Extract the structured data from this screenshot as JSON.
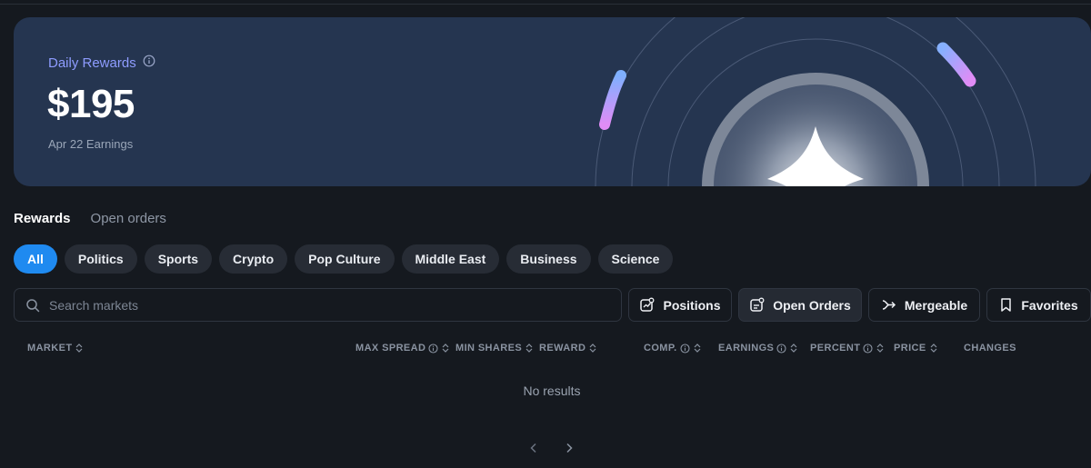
{
  "hero": {
    "title": "Daily Rewards",
    "amount": "$195",
    "subtitle": "Apr 22 Earnings"
  },
  "tabs": [
    {
      "label": "Rewards",
      "active": true
    },
    {
      "label": "Open orders",
      "active": false
    }
  ],
  "categories": [
    {
      "label": "All",
      "active": true
    },
    {
      "label": "Politics"
    },
    {
      "label": "Sports"
    },
    {
      "label": "Crypto"
    },
    {
      "label": "Pop Culture"
    },
    {
      "label": "Middle East"
    },
    {
      "label": "Business"
    },
    {
      "label": "Science"
    }
  ],
  "search": {
    "placeholder": "Search markets",
    "value": ""
  },
  "toolbar": {
    "positions": "Positions",
    "open_orders": "Open Orders",
    "mergeable": "Mergeable",
    "favorites": "Favorites"
  },
  "table": {
    "columns": {
      "market": "MARKET",
      "max_spread": "MAX SPREAD",
      "min_shares": "MIN SHARES",
      "reward": "REWARD",
      "comp": "COMP.",
      "earnings": "EARNINGS",
      "percent": "PERCENT",
      "price": "PRICE",
      "changes": "CHANGES"
    },
    "empty_text": "No results"
  },
  "colors": {
    "background": "#15191f",
    "hero_bg": "#253550",
    "accent": "#1f8af0",
    "hero_title": "#8e9cff"
  }
}
